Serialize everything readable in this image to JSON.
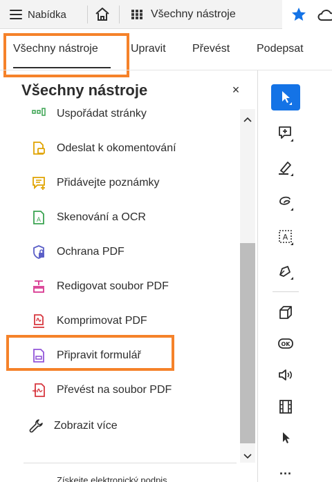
{
  "topbar": {
    "menu_label": "Nabídka",
    "all_tools_tab": "Všechny nástroje"
  },
  "tabs": [
    "Všechny nástroje",
    "Upravit",
    "Převést",
    "Podepsat"
  ],
  "panel": {
    "title": "Všechny nástroje",
    "close_glyph": "×",
    "items": [
      {
        "label": "Uspořádat stránky",
        "icon": "organize-pages-icon"
      },
      {
        "label": "Odeslat k okomentování",
        "icon": "send-for-comments-icon"
      },
      {
        "label": "Přidávejte poznámky",
        "icon": "add-comments-icon"
      },
      {
        "label": "Skenování a OCR",
        "icon": "scan-ocr-icon"
      },
      {
        "label": "Ochrana PDF",
        "icon": "protect-pdf-icon"
      },
      {
        "label": "Redigovat soubor PDF",
        "icon": "redact-icon"
      },
      {
        "label": "Komprimovat PDF",
        "icon": "compress-pdf-icon"
      },
      {
        "label": "Připravit formulář",
        "icon": "prepare-form-icon"
      },
      {
        "label": "Převést na soubor PDF",
        "icon": "create-pdf-icon"
      },
      {
        "label": "Zobrazit více",
        "icon": "wrench-icon"
      }
    ],
    "cutoff_text": "Získejte elektronický podpis"
  },
  "rail": {
    "more_label": "..."
  },
  "colors": {
    "highlight": "#f5822a",
    "accent": "#1473e6"
  }
}
